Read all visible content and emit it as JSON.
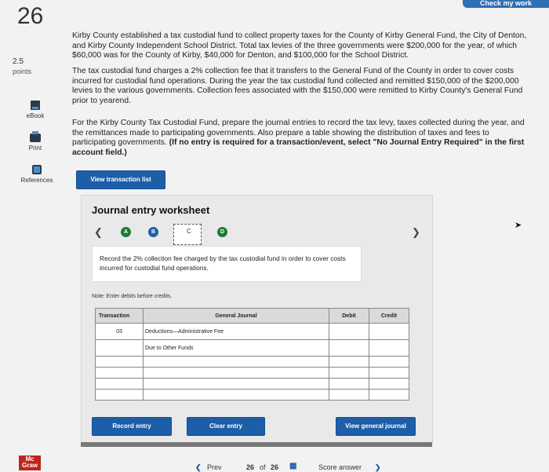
{
  "header": {
    "check_button": "Check my work"
  },
  "question": {
    "number": "26",
    "points_value": "2.5",
    "points_label": "points"
  },
  "sidebar": {
    "tools": [
      {
        "label": "eBook",
        "icon": "book-icon"
      },
      {
        "label": "Print",
        "icon": "printer-icon"
      },
      {
        "label": "References",
        "icon": "references-icon"
      }
    ]
  },
  "problem": {
    "para1": "Kirby County established a tax custodial fund to collect property taxes for the County of Kirby General Fund, the City of Denton, and Kirby County Independent School District. Total tax levies of the three governments were $200,000 for the year, of which $60,000 was for the County of Kirby, $40,000 for Denton, and $100,000 for the School District.",
    "para2": "The tax custodial fund charges a 2% collection fee that it transfers to the General Fund of the County in order to cover costs incurred for custodial fund operations. During the year the tax custodial fund collected and remitted $150,000 of the $200,000 levies to the various governments. Collection fees associated with the $150,000 were remitted to Kirby County's General Fund prior to yearend.",
    "para3": "For the Kirby County Tax Custodial Fund, prepare the journal entries to record the tax levy, taxes collected during the year, and the remittances made to participating governments. Also prepare a table showing the distribution of taxes and fees to participating governments.",
    "para3_bold": "(If no entry is required for a transaction/event, select \"No Journal Entry Required\" in the first account field.)"
  },
  "buttons": {
    "view_transactions": "View transaction list",
    "record_entry": "Record entry",
    "clear_entry": "Clear entry",
    "view_journal": "View general journal"
  },
  "worksheet": {
    "title": "Journal entry worksheet",
    "steps": [
      "A",
      "B",
      "C",
      "D"
    ],
    "instruction": "Record the 2% collection fee charged by the tax custodial fund in order to cover costs incurred for custodial fund operations.",
    "note": "Note: Enter debits before credits.",
    "columns": {
      "transaction": "Transaction",
      "journal": "General Journal",
      "debit": "Debit",
      "credit": "Credit"
    },
    "rows": [
      {
        "transaction": "03",
        "account": "Deductions—Administrative Fee",
        "debit": "",
        "credit": ""
      },
      {
        "transaction": "",
        "account": "Due to Other Funds",
        "debit": "",
        "credit": ""
      },
      {
        "transaction": "",
        "account": "",
        "debit": "",
        "credit": ""
      },
      {
        "transaction": "",
        "account": "",
        "debit": "",
        "credit": ""
      },
      {
        "transaction": "",
        "account": "",
        "debit": "",
        "credit": ""
      },
      {
        "transaction": "",
        "account": "",
        "debit": "",
        "credit": ""
      }
    ]
  },
  "footer": {
    "prev": "Prev",
    "page_current": "26",
    "page_of": "of",
    "page_total": "26",
    "next_label": "Score answer",
    "logo_line1": "Mc",
    "logo_line2": "Graw"
  }
}
